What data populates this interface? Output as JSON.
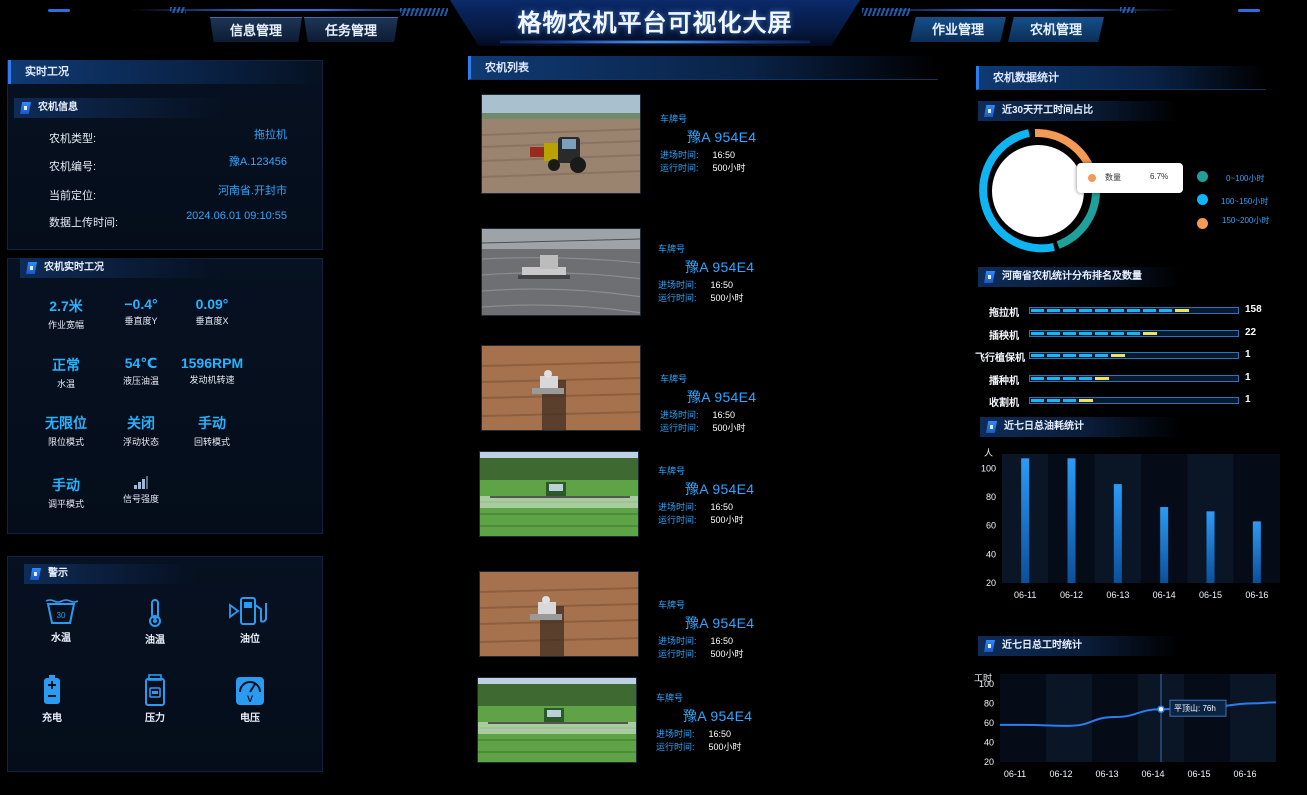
{
  "header": {
    "title": "格物农机平台可视化大屏",
    "nav_left": [
      "信息管理",
      "任务管理"
    ],
    "nav_right": [
      "作业管理",
      "农机管理"
    ]
  },
  "realtime": {
    "title": "实时工况",
    "info": {
      "title": "农机信息",
      "rows": [
        {
          "label": "农机类型:",
          "value": "拖拉机"
        },
        {
          "label": "农机编号:",
          "value": "豫A.123456"
        },
        {
          "label": "当前定位:",
          "value": "河南省.开封市"
        },
        {
          "label": "数据上传时间:",
          "value": "2024.06.01  09:10:55"
        }
      ]
    },
    "status": {
      "title": "农机实时工况",
      "items": [
        {
          "value": "2.7米",
          "label": "作业宽幅"
        },
        {
          "value": "−0.4°",
          "label": "垂直度Y"
        },
        {
          "value": "0.09°",
          "label": "垂直度X"
        },
        {
          "value": "正常",
          "label": "水温"
        },
        {
          "value": "54℃",
          "label": "液压油温"
        },
        {
          "value": "1596RPM",
          "label": "发动机转速"
        },
        {
          "value": "无限位",
          "label": "限位模式"
        },
        {
          "value": "关闭",
          "label": "浮动状态"
        },
        {
          "value": "手动",
          "label": "回转模式"
        },
        {
          "value": "手动",
          "label": "调平模式"
        },
        {
          "value": "",
          "label": "信号强度",
          "icon": "signal-icon"
        }
      ]
    },
    "warnings": {
      "title": "警示",
      "items": [
        {
          "label": "水温",
          "icon": "water-temp-icon"
        },
        {
          "label": "油温",
          "icon": "thermometer-icon"
        },
        {
          "label": "油位",
          "icon": "fuel-pump-icon"
        },
        {
          "label": "充电",
          "icon": "battery-icon"
        },
        {
          "label": "压力",
          "icon": "pressure-icon"
        },
        {
          "label": "电压",
          "icon": "voltmeter-icon"
        }
      ],
      "icon_color": "#2a9bf0"
    }
  },
  "machine_list": {
    "title": "农机列表",
    "cards": [
      {
        "plate_label": "车牌号",
        "plate": "豫A 954E4",
        "in_label": "进场时间:",
        "in_time": "16:50",
        "run_label": "运行时间:",
        "run_time": "500小时",
        "scene": "tractor"
      },
      {
        "plate_label": "车牌号",
        "plate": "豫A 954E4",
        "in_label": "进场时间:",
        "in_time": "16:50",
        "run_label": "运行时间:",
        "run_time": "500小时",
        "scene": "paddy"
      },
      {
        "plate_label": "车牌号",
        "plate": "豫A 954E4",
        "in_label": "进场时间:",
        "in_time": "16:50",
        "run_label": "运行时间:",
        "run_time": "500小时",
        "scene": "soil"
      },
      {
        "plate_label": "车牌号",
        "plate": "豫A 954E4",
        "in_label": "进场时间:",
        "in_time": "16:50",
        "run_label": "运行时间:",
        "run_time": "500小时",
        "scene": "sprayer"
      },
      {
        "plate_label": "车牌号",
        "plate": "豫A 954E4",
        "in_label": "进场时间:",
        "in_time": "16:50",
        "run_label": "运行时间:",
        "run_time": "500小时",
        "scene": "soil"
      },
      {
        "plate_label": "车牌号",
        "plate": "豫A 954E4",
        "in_label": "进场时间:",
        "in_time": "16:50",
        "run_label": "运行时间:",
        "run_time": "500小时",
        "scene": "sprayer"
      }
    ]
  },
  "stats": {
    "title": "农机数据统计",
    "donut": {
      "title": "近30天开工时间占比",
      "tooltip_label": "数量",
      "tooltip_value": "6.7%",
      "legend": [
        {
          "label": "0~100小时",
          "color": "#1fa09a"
        },
        {
          "label": "100~150小时",
          "color": "#0fb5f2"
        },
        {
          "label": "150~200小时",
          "color": "#f39a55"
        }
      ]
    },
    "ranking": {
      "title": "河南省农机统计分布排名及数量",
      "items": [
        {
          "name": "拖拉机",
          "count": "158",
          "fill": 0.84
        },
        {
          "name": "插秧机",
          "count": "22",
          "fill": 0.67
        },
        {
          "name": "飞行植保机",
          "count": "1",
          "fill": 0.52
        },
        {
          "name": "播种机",
          "count": "1",
          "fill": 0.41
        },
        {
          "name": "收割机",
          "count": "1",
          "fill": 0.35
        }
      ]
    }
  },
  "chart_data": [
    {
      "type": "bar",
      "title": "近七日总油耗统计",
      "ylabel": "人",
      "categories": [
        "06-11",
        "06-12",
        "06-13",
        "06-14",
        "06-15",
        "06-16"
      ],
      "values": [
        107,
        107,
        89,
        73,
        70,
        63
      ],
      "ylim": [
        20,
        110
      ],
      "yticks": [
        "100",
        "80",
        "60",
        "40",
        "20"
      ],
      "grid": false,
      "color": "#1e8fe8"
    },
    {
      "type": "line",
      "title": "近七日总工时统计",
      "ylabel": "工时",
      "categories": [
        "06-11",
        "06-12",
        "06-13",
        "06-14",
        "06-15",
        "06-16"
      ],
      "values": [
        58,
        57,
        66,
        74,
        76,
        80
      ],
      "ylim": [
        20,
        110
      ],
      "yticks": [
        "100",
        "80",
        "60",
        "40",
        "20"
      ],
      "tooltip": "平顶山: 76h",
      "color": "#2a7df0"
    }
  ]
}
